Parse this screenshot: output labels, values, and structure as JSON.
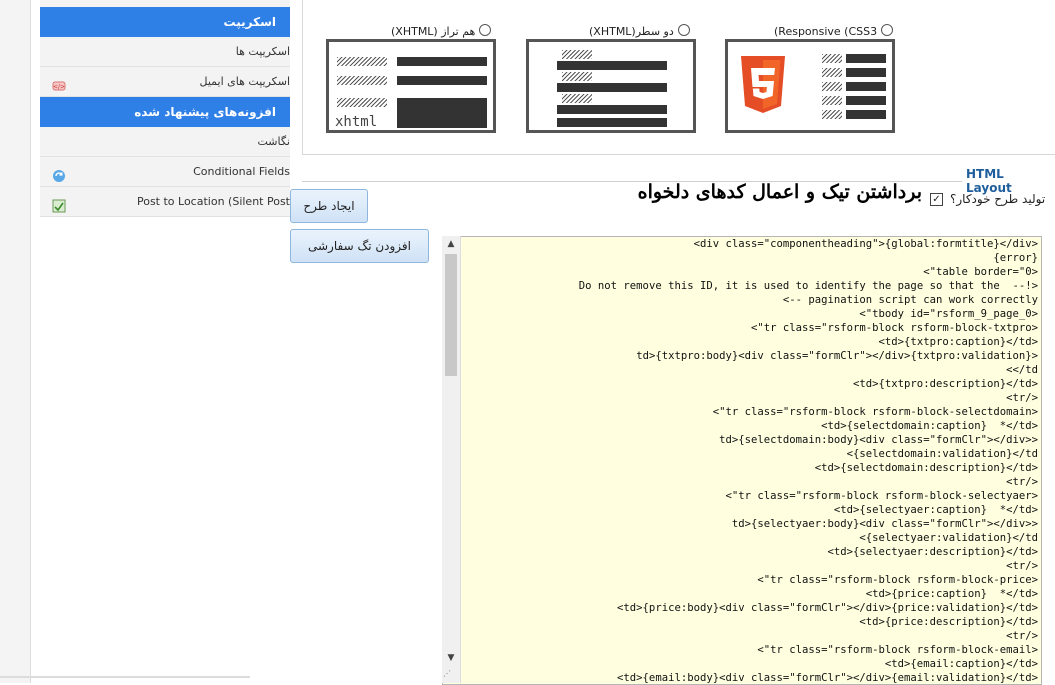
{
  "sidebar": {
    "head1": "اسکریپت",
    "item1": "اسکریپت ها",
    "item2": "اسکریپت های ایمیل",
    "head2": "افزونه‌های پیشنهاد شده",
    "item3": "نگاشت",
    "item4": "Conditional Fields",
    "item5": "Post to Location (Silent Post"
  },
  "templates": {
    "t1": "(Responsive (CSS3",
    "t2": "(XHTML)دو سطر",
    "t3": "(XHTML) هم تراز",
    "t3_box_text": "xhtml"
  },
  "layout": {
    "legend": "HTML Layout",
    "auto_generate": "تولید طرح خودکار؟",
    "check_mark": "✓",
    "handwritten_note": "برداشتن تیک و اعمال کدهای دلخواه",
    "btn_create": "ایجاد طرح",
    "btn_add_tag": "افزودن تگ سفارشی"
  },
  "editor": {
    "lines": [
      "<div class=\"componentheading\">{global:formtitle}</div>",
      "{error}",
      "<\"table border=\"0>",
      "Do not remove this ID, it is used to identify the page so that the  --!>",
      "<-- pagination script can work correctly",
      "<\"tbody id=\"rsform_9_page_0>",
      "<\"tr class=\"rsform-block rsform-block-txtpro>",
      "<td>{txtpro:caption}</td>",
      "td>{txtpro:body}<div class=\"formClr\"></div>{txtpro:validation}>",
      "<</td",
      "<td>{txtpro:description}</td>",
      "<tr/>",
      "<\"tr class=\"rsform-block rsform-block-selectdomain>",
      "<td>{selectdomain:caption}  *</td>",
      "td>{selectdomain:body}<div class=\"formClr\"></div>>",
      "<{selectdomain:validation}</td",
      "<td>{selectdomain:description}</td>",
      "<tr/>",
      "<\"tr class=\"rsform-block rsform-block-selectyaer>",
      "<td>{selectyaer:caption}  *</td>",
      "td>{selectyaer:body}<div class=\"formClr\"></div>>",
      "<{selectyaer:validation}</td",
      "<td>{selectyaer:description}</td>",
      "<tr/>",
      "<\"tr class=\"rsform-block rsform-block-price>",
      "<td>{price:caption}  *</td>",
      "<td>{price:body}<div class=\"formClr\"></div>{price:validation}</td>",
      "<td>{price:description}</td>",
      "<tr/>",
      "<\"tr class=\"rsform-block rsform-block-email>",
      "<td>{email:caption}</td>",
      "<td>{email:body}<div class=\"formClr\"></div>{email:validation}</td>"
    ]
  }
}
